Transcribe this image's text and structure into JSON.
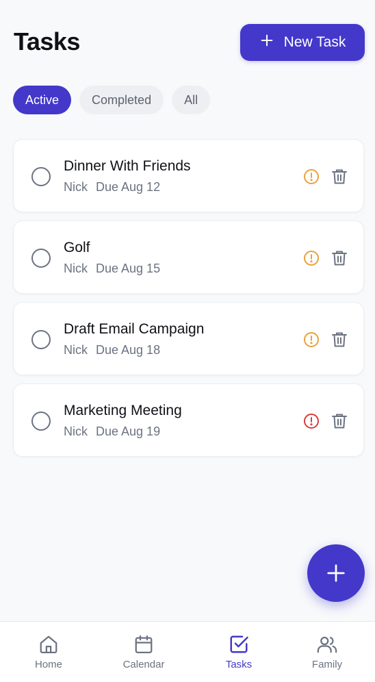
{
  "header": {
    "title": "Tasks",
    "new_task_label": "New Task"
  },
  "filters": [
    {
      "label": "Active",
      "active": true
    },
    {
      "label": "Completed",
      "active": false
    },
    {
      "label": "All",
      "active": false
    }
  ],
  "tasks": [
    {
      "title": "Dinner With Friends",
      "assignee": "Nick",
      "due": "Due Aug 12",
      "priority_color": "#e8a23a"
    },
    {
      "title": "Golf",
      "assignee": "Nick",
      "due": "Due Aug 15",
      "priority_color": "#e8a23a"
    },
    {
      "title": "Draft Email Campaign",
      "assignee": "Nick",
      "due": "Due Aug 18",
      "priority_color": "#e8a23a"
    },
    {
      "title": "Marketing Meeting",
      "assignee": "Nick",
      "due": "Due Aug 19",
      "priority_color": "#dc3b3b"
    }
  ],
  "nav": [
    {
      "label": "Home",
      "icon": "home-icon",
      "active": false
    },
    {
      "label": "Calendar",
      "icon": "calendar-icon",
      "active": false
    },
    {
      "label": "Tasks",
      "icon": "check-square-icon",
      "active": true
    },
    {
      "label": "Family",
      "icon": "users-icon",
      "active": false
    }
  ],
  "colors": {
    "accent": "#4338ca",
    "priority_medium": "#e8a23a",
    "priority_high": "#dc3b3b"
  }
}
